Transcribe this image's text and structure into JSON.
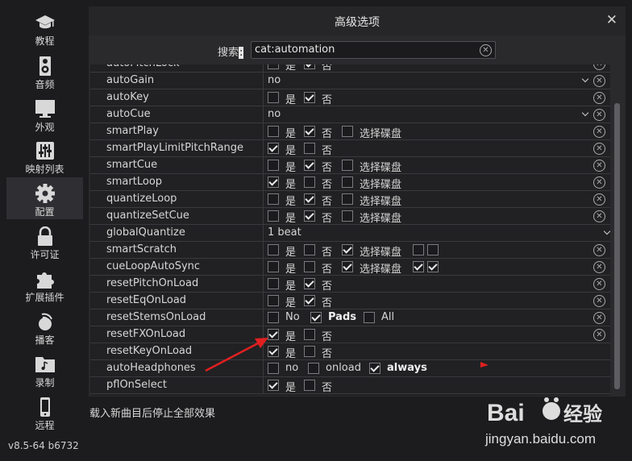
{
  "sidebar": {
    "items": [
      {
        "label": "教程",
        "icon": "graduation-cap-icon"
      },
      {
        "label": "音频",
        "icon": "speaker-icon"
      },
      {
        "label": "外观",
        "icon": "monitor-icon"
      },
      {
        "label": "映射列表",
        "icon": "mixer-sliders-icon"
      },
      {
        "label": "配置",
        "icon": "gear-icon",
        "active": true
      },
      {
        "label": "许可证",
        "icon": "lock-icon"
      },
      {
        "label": "扩展插件",
        "icon": "puzzle-icon"
      },
      {
        "label": "播客",
        "icon": "podcast-icon"
      },
      {
        "label": "录制",
        "icon": "music-folder-icon"
      },
      {
        "label": "远程",
        "icon": "phone-icon"
      }
    ],
    "version": "v8.5-64 b6732"
  },
  "dialog": {
    "title": "高级选项",
    "close": "✕",
    "search_label": "搜索",
    "search_colon": ":",
    "search_value": "cat:automation"
  },
  "labels": {
    "yes": "是",
    "no": "否",
    "select_deck": "选择碟盘",
    "no_en": "No",
    "pads": "Pads",
    "all": "All",
    "onload": "onload",
    "always": "always"
  },
  "rows": [
    {
      "name": "autoPitchLock"
    },
    {
      "name": "autoGain",
      "value": "no"
    },
    {
      "name": "autoKey"
    },
    {
      "name": "autoCue",
      "value": "no"
    },
    {
      "name": "smartPlay"
    },
    {
      "name": "smartPlayLimitPitchRange"
    },
    {
      "name": "smartCue"
    },
    {
      "name": "smartLoop"
    },
    {
      "name": "quantizeLoop"
    },
    {
      "name": "quantizeSetCue"
    },
    {
      "name": "globalQuantize",
      "value": "1 beat"
    },
    {
      "name": "smartScratch"
    },
    {
      "name": "cueLoopAutoSync"
    },
    {
      "name": "resetPitchOnLoad"
    },
    {
      "name": "resetEqOnLoad"
    },
    {
      "name": "resetStemsOnLoad"
    },
    {
      "name": "resetFXOnLoad"
    },
    {
      "name": "resetKeyOnLoad"
    },
    {
      "name": "autoHeadphones"
    },
    {
      "name": "pflOnSelect"
    }
  ],
  "footer_note": "载入新曲目后停止全部效果",
  "watermark": {
    "brand_a": "Bai",
    "brand_b": "经验",
    "site": "jingyan.baidu.com"
  },
  "colors": {
    "background": "#1c1c1e",
    "panel": "#2a2a2c",
    "annotation_red": "#e02020"
  }
}
